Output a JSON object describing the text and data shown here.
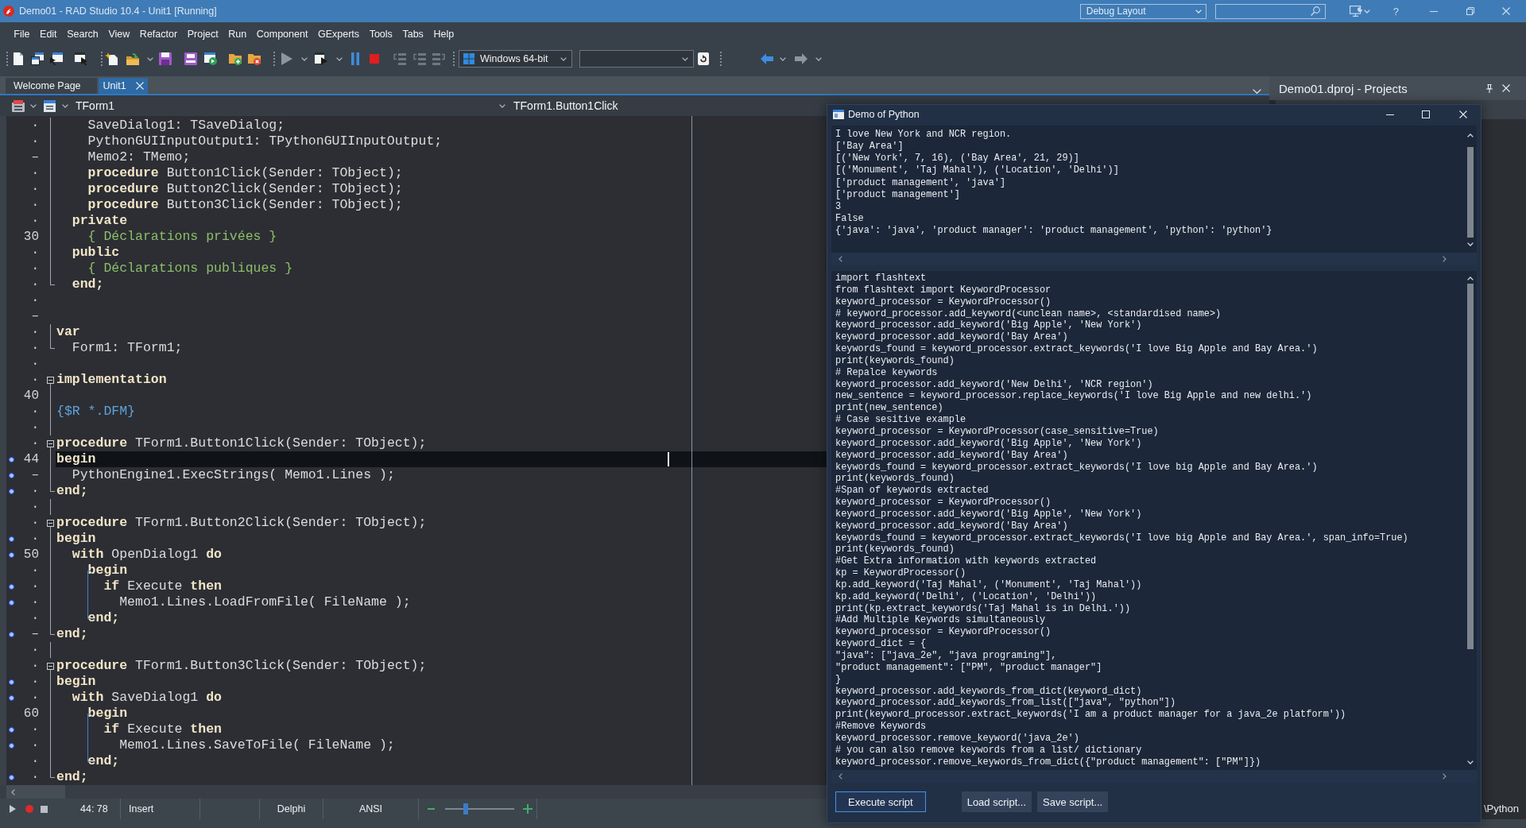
{
  "window": {
    "title": "Demo01 - RAD Studio 10.4 - Unit1 [Running]",
    "layout": "Debug Layout",
    "help": "?"
  },
  "menu": [
    "File",
    "Edit",
    "Search",
    "View",
    "Refactor",
    "Project",
    "Run",
    "Component",
    "GExperts",
    "Tools",
    "Tabs",
    "Help"
  ],
  "toolbar": {
    "platform": "Windows 64-bit"
  },
  "tabs": [
    {
      "label": "Welcome Page",
      "selected": false
    },
    {
      "label": "Unit1",
      "selected": true
    }
  ],
  "projects_panel": {
    "title": "Demo01.dproj - Projects",
    "path": "\\Python"
  },
  "editor": {
    "class": "TForm1",
    "method": "TForm1.Button1Click",
    "lines": [
      {
        "gutter": "·",
        "kind": "code",
        "text": "    SaveDialog1: TSaveDialog;",
        "executable": false,
        "current": false,
        "fold_start": false,
        "fold_end": false,
        "in_fold": true,
        "in_block": false
      },
      {
        "gutter": "·",
        "kind": "code",
        "text": "    PythonGUIInputOutput1: TPythonGUIInputOutput;",
        "executable": false,
        "current": false,
        "fold_start": false,
        "fold_end": false,
        "in_fold": true,
        "in_block": false
      },
      {
        "gutter": "–",
        "kind": "code",
        "text": "    Memo2: TMemo;",
        "executable": false,
        "current": false,
        "fold_start": false,
        "fold_end": false,
        "in_fold": true,
        "in_block": false
      },
      {
        "gutter": "·",
        "kind": "code",
        "text": "    **procedure** Button1Click(Sender: TObject);",
        "executable": false,
        "current": false,
        "fold_start": false,
        "fold_end": false,
        "in_fold": true,
        "in_block": false
      },
      {
        "gutter": "·",
        "kind": "code",
        "text": "    **procedure** Button2Click(Sender: TObject);",
        "executable": false,
        "current": false,
        "fold_start": false,
        "fold_end": false,
        "in_fold": true,
        "in_block": false
      },
      {
        "gutter": "·",
        "kind": "code",
        "text": "    **procedure** Button3Click(Sender: TObject);",
        "executable": false,
        "current": false,
        "fold_start": false,
        "fold_end": false,
        "in_fold": true,
        "in_block": false
      },
      {
        "gutter": "·",
        "kind": "keyword",
        "text": "  private",
        "executable": false,
        "current": false,
        "fold_start": false,
        "fold_end": false,
        "in_fold": true,
        "in_block": false
      },
      {
        "gutter": "30",
        "kind": "comment",
        "text": "    { Déclarations privées }",
        "executable": false,
        "current": false,
        "fold_start": false,
        "fold_end": false,
        "in_fold": true,
        "in_block": false
      },
      {
        "gutter": "·",
        "kind": "keyword",
        "text": "  public",
        "executable": false,
        "current": false,
        "fold_start": false,
        "fold_end": false,
        "in_fold": true,
        "in_block": false
      },
      {
        "gutter": "·",
        "kind": "comment",
        "text": "    { Déclarations publiques }",
        "executable": false,
        "current": false,
        "fold_start": false,
        "fold_end": false,
        "in_fold": true,
        "in_block": false
      },
      {
        "gutter": "·",
        "kind": "keyword",
        "text": "  end;",
        "executable": false,
        "current": false,
        "fold_start": false,
        "fold_end": true,
        "in_fold": false,
        "in_block": false
      },
      {
        "gutter": "·",
        "kind": "blank",
        "executable": false,
        "current": false,
        "fold_start": false,
        "fold_end": false,
        "in_fold": false,
        "in_block": false
      },
      {
        "gutter": "–",
        "kind": "blank",
        "executable": false,
        "current": false,
        "fold_start": false,
        "fold_end": false,
        "in_fold": false,
        "in_block": false
      },
      {
        "gutter": "·",
        "kind": "keyword",
        "text": "var",
        "executable": false,
        "current": false,
        "fold_start": false,
        "fold_end": false,
        "in_fold": true,
        "in_block": false
      },
      {
        "gutter": "·",
        "kind": "code",
        "text": "  Form1: TForm1;",
        "executable": false,
        "current": false,
        "fold_start": false,
        "fold_end": true,
        "in_fold": false,
        "in_block": false
      },
      {
        "gutter": "·",
        "kind": "blank",
        "executable": false,
        "current": false,
        "fold_start": false,
        "fold_end": false,
        "in_fold": false,
        "in_block": false
      },
      {
        "gutter": "·",
        "kind": "keyword",
        "text": "implementation",
        "executable": false,
        "current": false,
        "fold_start": true,
        "fold_end": false,
        "in_fold": true,
        "in_block": false
      },
      {
        "gutter": "40",
        "kind": "blank",
        "executable": false,
        "current": false,
        "fold_start": false,
        "fold_end": false,
        "in_fold": true,
        "in_block": false
      },
      {
        "gutter": "·",
        "kind": "directive",
        "text": "{$R *.DFM}",
        "executable": false,
        "current": false,
        "fold_start": false,
        "fold_end": false,
        "in_fold": true,
        "in_block": false
      },
      {
        "gutter": "·",
        "kind": "blank",
        "executable": false,
        "current": false,
        "fold_start": false,
        "fold_end": false,
        "in_fold": true,
        "in_block": false
      },
      {
        "gutter": "·",
        "kind": "code",
        "text": "**procedure** TForm1.Button1Click(Sender: TObject);",
        "executable": false,
        "current": false,
        "fold_start": true,
        "fold_end": false,
        "in_fold": true,
        "in_block": false
      },
      {
        "gutter": "44",
        "kind": "keyword",
        "text": "begin",
        "executable": true,
        "current": true,
        "fold_start": false,
        "fold_end": false,
        "in_fold": true,
        "in_block": false
      },
      {
        "gutter": "–",
        "kind": "code",
        "text": "  PythonEngine1.ExecStrings( Memo1.Lines );",
        "executable": true,
        "current": false,
        "fold_start": false,
        "fold_end": false,
        "in_fold": true,
        "in_block": false
      },
      {
        "gutter": "·",
        "kind": "keyword",
        "text": "end;",
        "executable": true,
        "current": false,
        "fold_start": false,
        "fold_end": true,
        "in_fold": false,
        "in_block": false
      },
      {
        "gutter": "·",
        "kind": "blank",
        "executable": false,
        "current": false,
        "fold_start": false,
        "fold_end": false,
        "in_fold": true,
        "in_block": false
      },
      {
        "gutter": "·",
        "kind": "code",
        "text": "**procedure** TForm1.Button2Click(Sender: TObject);",
        "executable": false,
        "current": false,
        "fold_start": true,
        "fold_end": false,
        "in_fold": true,
        "in_block": false
      },
      {
        "gutter": "·",
        "kind": "keyword",
        "text": "begin",
        "executable": true,
        "current": false,
        "fold_start": false,
        "fold_end": false,
        "in_fold": true,
        "in_block": false
      },
      {
        "gutter": "50",
        "kind": "code",
        "text": "  **with** OpenDialog1 **do**",
        "executable": true,
        "current": false,
        "fold_start": false,
        "fold_end": false,
        "in_fold": true,
        "in_block": false
      },
      {
        "gutter": "·",
        "kind": "keyword",
        "text": "    begin",
        "executable": false,
        "current": false,
        "fold_start": false,
        "fold_end": false,
        "in_fold": true,
        "in_block": true
      },
      {
        "gutter": "·",
        "kind": "code",
        "text": "      **if** Execute **then**",
        "executable": true,
        "current": false,
        "fold_start": false,
        "fold_end": false,
        "in_fold": true,
        "in_block": true
      },
      {
        "gutter": "·",
        "kind": "code",
        "text": "        Memo1.Lines.LoadFromFile( FileName );",
        "executable": true,
        "current": false,
        "fold_start": false,
        "fold_end": false,
        "in_fold": true,
        "in_block": true
      },
      {
        "gutter": "·",
        "kind": "keyword",
        "text": "    end;",
        "executable": false,
        "current": false,
        "fold_start": false,
        "fold_end": false,
        "in_fold": true,
        "in_block": true
      },
      {
        "gutter": "–",
        "kind": "keyword",
        "text": "end;",
        "executable": true,
        "current": false,
        "fold_start": false,
        "fold_end": true,
        "in_fold": false,
        "in_block": false
      },
      {
        "gutter": "·",
        "kind": "blank",
        "executable": false,
        "current": false,
        "fold_start": false,
        "fold_end": false,
        "in_fold": true,
        "in_block": false
      },
      {
        "gutter": "·",
        "kind": "code",
        "text": "**procedure** TForm1.Button3Click(Sender: TObject);",
        "executable": false,
        "current": false,
        "fold_start": true,
        "fold_end": false,
        "in_fold": true,
        "in_block": false
      },
      {
        "gutter": "·",
        "kind": "keyword",
        "text": "begin",
        "executable": true,
        "current": false,
        "fold_start": false,
        "fold_end": false,
        "in_fold": true,
        "in_block": false
      },
      {
        "gutter": "·",
        "kind": "code",
        "text": "  **with** SaveDialog1 **do**",
        "executable": true,
        "current": false,
        "fold_start": false,
        "fold_end": false,
        "in_fold": true,
        "in_block": false
      },
      {
        "gutter": "60",
        "kind": "keyword",
        "text": "    begin",
        "executable": false,
        "current": false,
        "fold_start": false,
        "fold_end": false,
        "in_fold": true,
        "in_block": true
      },
      {
        "gutter": "·",
        "kind": "code",
        "text": "      **if** Execute **then**",
        "executable": true,
        "current": false,
        "fold_start": false,
        "fold_end": false,
        "in_fold": true,
        "in_block": true
      },
      {
        "gutter": "·",
        "kind": "code",
        "text": "        Memo1.Lines.SaveToFile( FileName );",
        "executable": true,
        "current": false,
        "fold_start": false,
        "fold_end": false,
        "in_fold": true,
        "in_block": true
      },
      {
        "gutter": "·",
        "kind": "keyword",
        "text": "    end;",
        "executable": false,
        "current": false,
        "fold_start": false,
        "fold_end": false,
        "in_fold": true,
        "in_block": true
      },
      {
        "gutter": "·",
        "kind": "keyword",
        "text": "end;",
        "executable": true,
        "current": false,
        "fold_start": false,
        "fold_end": true,
        "in_fold": false,
        "in_block": false
      }
    ]
  },
  "status_bar": {
    "position": "44: 78",
    "mode": "Insert",
    "language": "Delphi",
    "encoding": "ANSI",
    "zoom": {
      "level": 0.29
    }
  },
  "python_window": {
    "title": "Demo of Python",
    "output": [
      "I love New York and NCR region.",
      "['Bay Area']",
      "[('New York', 7, 16), ('Bay Area', 21, 29)]",
      "[('Monument', 'Taj Mahal'), ('Location', 'Delhi')]",
      "['product management', 'java']",
      "['product management']",
      "3",
      "False",
      "{'java': 'java', 'product manager': 'product management', 'python': 'python'}"
    ],
    "script": [
      "import flashtext",
      "from flashtext import KeywordProcessor",
      "keyword_processor = KeywordProcessor()",
      "# keyword_processor.add_keyword(<unclean name>, <standardised name>)",
      "keyword_processor.add_keyword('Big Apple', 'New York')",
      "keyword_processor.add_keyword('Bay Area')",
      "keywords_found = keyword_processor.extract_keywords('I love Big Apple and Bay Area.')",
      "print(keywords_found)",
      "# Repalce keywords",
      "keyword_processor.add_keyword('New Delhi', 'NCR region')",
      "new_sentence = keyword_processor.replace_keywords('I love Big Apple and new delhi.')",
      "print(new_sentence)",
      "# Case sesitive example",
      "keyword_processor = KeywordProcessor(case_sensitive=True)",
      "keyword_processor.add_keyword('Big Apple', 'New York')",
      "keyword_processor.add_keyword('Bay Area')",
      "keywords_found = keyword_processor.extract_keywords('I love big Apple and Bay Area.')",
      "print(keywords_found)",
      "#Span of keywords extracted",
      "keyword_processor = KeywordProcessor()",
      "keyword_processor.add_keyword('Big Apple', 'New York')",
      "keyword_processor.add_keyword('Bay Area')",
      "keywords_found = keyword_processor.extract_keywords('I love big Apple and Bay Area.', span_info=True)",
      "print(keywords_found)",
      "#Get Extra information with keywords extracted",
      "kp = KeywordProcessor()",
      "kp.add_keyword('Taj Mahal', ('Monument', 'Taj Mahal'))",
      "kp.add_keyword('Delhi', ('Location', 'Delhi'))",
      "print(kp.extract_keywords('Taj Mahal is in Delhi.'))",
      "#Add Multiple Keywords simultaneously",
      "keyword_processor = KeywordProcessor()",
      "keyword_dict = {",
      "\"java\": [\"java_2e\", \"java programing\"],",
      "\"product management\": [\"PM\", \"product manager\"]",
      "}",
      "keyword_processor.add_keywords_from_dict(keyword_dict)",
      "keyword_processor.add_keywords_from_list([\"java\", \"python\"])",
      "print(keyword_processor.extract_keywords('I am a product manager for a java_2e platform'))",
      "#Remove Keywords",
      "keyword_processor.remove_keyword('java_2e')",
      "# you can also remove keywords from a list/ dictionary",
      "keyword_processor.remove_keywords_from_dict({\"product management\": [\"PM\"]})"
    ],
    "buttons": [
      {
        "label": "Execute script",
        "focused": true
      },
      {
        "label": "Load script...",
        "focused": false
      },
      {
        "label": "Save script...",
        "focused": false
      }
    ]
  }
}
